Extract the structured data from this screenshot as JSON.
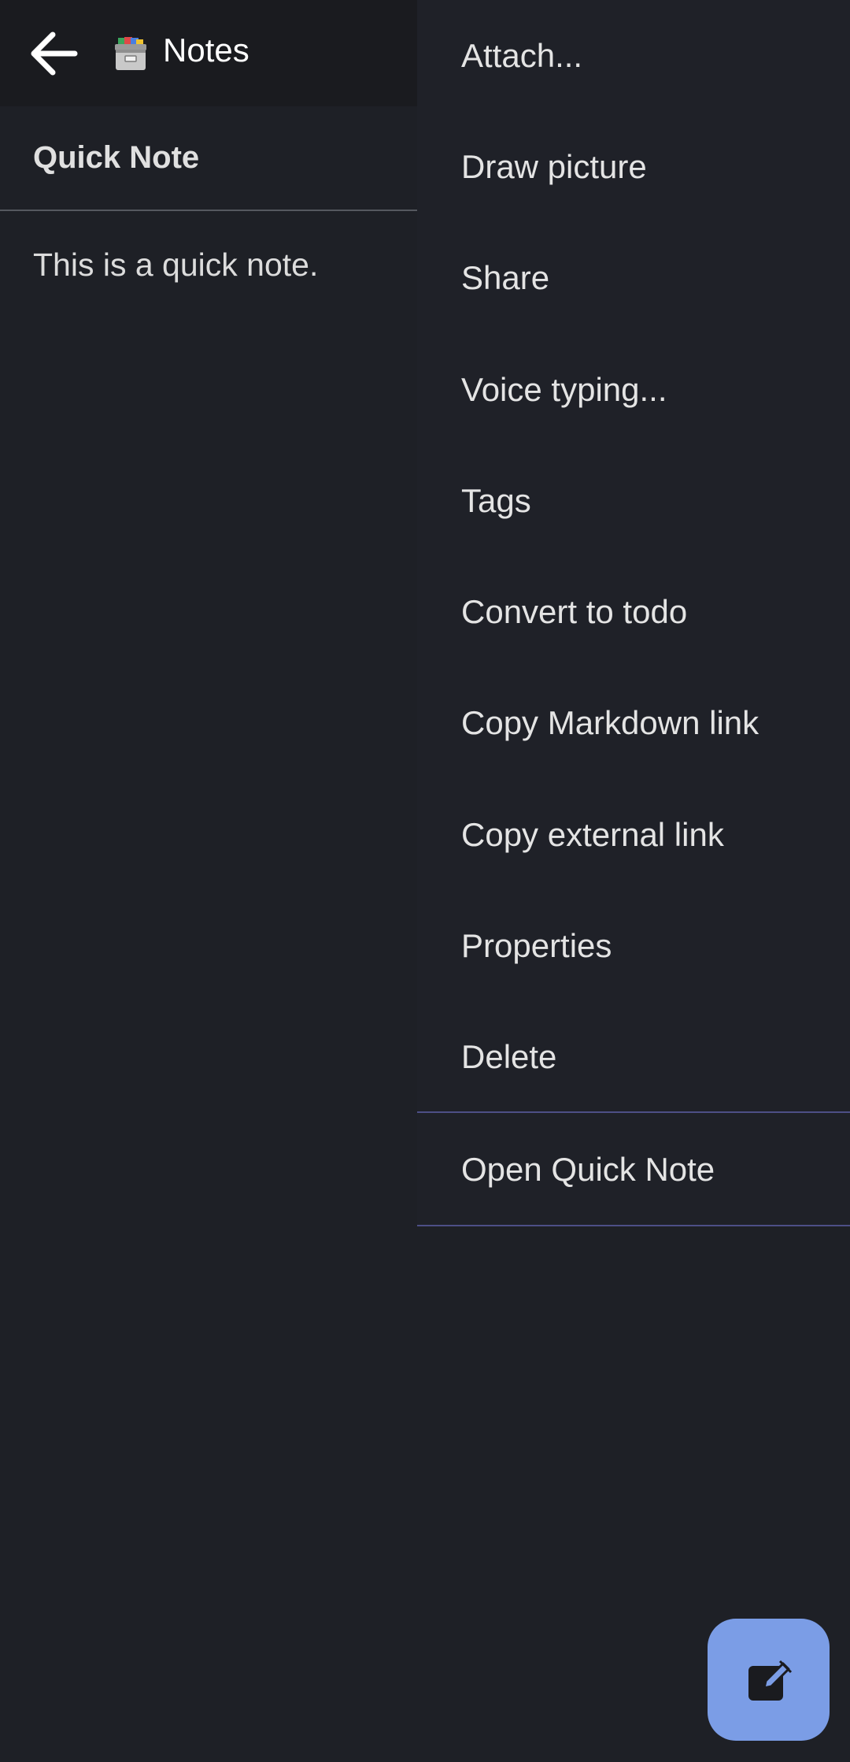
{
  "header": {
    "title": "Notes",
    "back_icon": "arrow-left-icon",
    "folder_icon": "file-cabinet-icon"
  },
  "note": {
    "title": "Quick Note",
    "body": "This is a quick note."
  },
  "menu": {
    "items": [
      {
        "label": "Attach..."
      },
      {
        "label": "Draw picture"
      },
      {
        "label": "Share"
      },
      {
        "label": "Voice typing..."
      },
      {
        "label": "Tags"
      },
      {
        "label": "Convert to todo"
      },
      {
        "label": "Copy Markdown link"
      },
      {
        "label": "Copy external link"
      },
      {
        "label": "Properties"
      },
      {
        "label": "Delete"
      },
      {
        "label": "Open Quick Note"
      }
    ]
  },
  "fab": {
    "icon": "edit-note-icon"
  },
  "colors": {
    "background": "#1e2026",
    "header_background": "#1a1b1f",
    "menu_background": "#1f2128",
    "menu_separator": "#4d4f86",
    "fab": "#7b9de6"
  }
}
